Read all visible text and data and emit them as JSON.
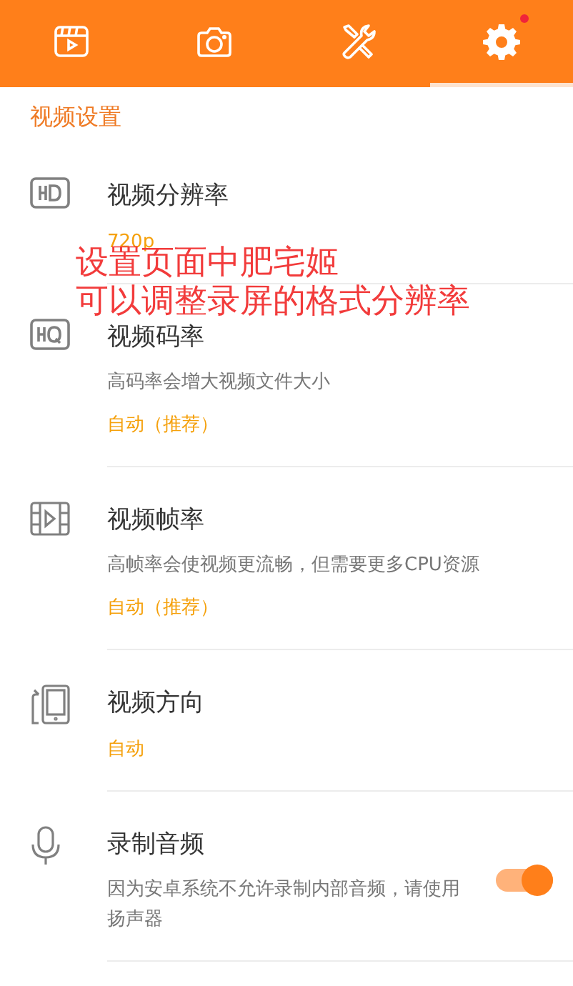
{
  "tabs": [
    {
      "kind": "video",
      "selected": false,
      "badge": false
    },
    {
      "kind": "camera",
      "selected": false,
      "badge": false
    },
    {
      "kind": "tools",
      "selected": false,
      "badge": false
    },
    {
      "kind": "settings",
      "selected": true,
      "badge": true
    }
  ],
  "section_title": "视频设置",
  "settings": [
    {
      "kind": "hd",
      "title": "视频分辨率",
      "value": "720p"
    },
    {
      "kind": "hq",
      "title": "视频码率",
      "description": "高码率会增大视频文件大小",
      "value": "自动（推荐）"
    },
    {
      "kind": "frames",
      "title": "视频帧率",
      "description": "高帧率会使视频更流畅，但需要更多CPU资源",
      "value": "自动（推荐）"
    },
    {
      "kind": "orientation",
      "title": "视频方向",
      "value": "自动"
    },
    {
      "kind": "mic",
      "title": "录制音频",
      "description": "因为安卓系统不允许录制内部音频，请使用扬声器",
      "toggle": {
        "on": true
      }
    }
  ],
  "annotation": [
    "设置页面中肥宅姬",
    "可以调整录屏的格式分辨率"
  ]
}
